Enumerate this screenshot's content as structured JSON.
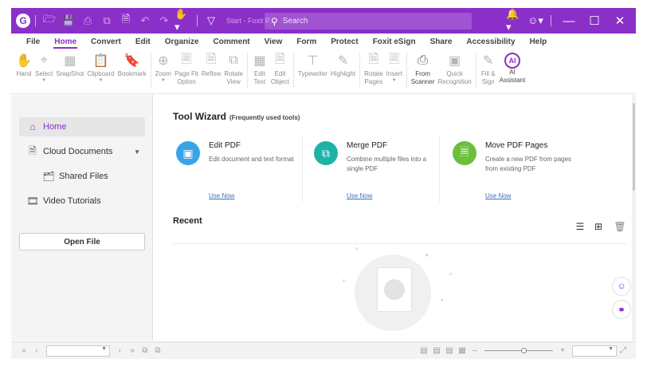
{
  "titlebar": {
    "doc_title": "Start - Foxit P...",
    "search_placeholder": "Search",
    "accent": "#8b2fc9"
  },
  "menu": {
    "tabs": [
      "File",
      "Home",
      "Convert",
      "Edit",
      "Organize",
      "Comment",
      "View",
      "Form",
      "Protect",
      "Foxit eSign",
      "Share",
      "Accessibility",
      "Help"
    ],
    "active": "Home"
  },
  "ribbon": {
    "hand": "Hand",
    "select": "Select",
    "snapshot": "SnapShot",
    "clipboard": "Clipboard",
    "bookmark": "Bookmark",
    "zoom": "Zoom",
    "page_fit_1": "Page Fit",
    "page_fit_2": "Option",
    "reflow": "Reflow",
    "rotate_view_1": "Rotate",
    "rotate_view_2": "View",
    "edit_text_1": "Edit",
    "edit_text_2": "Text",
    "edit_object_1": "Edit",
    "edit_object_2": "Object",
    "typewriter": "Typewriter",
    "highlight": "Highlight",
    "rotate_pages_1": "Rotate",
    "rotate_pages_2": "Pages",
    "insert": "Insert",
    "from_scanner_1": "From",
    "from_scanner_2": "Scanner",
    "quick_recognition_1": "Quick",
    "quick_recognition_2": "Recognition",
    "fill_sign_1": "Fill &",
    "fill_sign_2": "Sign",
    "ai_assistant_1": "AI",
    "ai_assistant_2": "Assistant",
    "ai_icon_text": "AI"
  },
  "sidebar": {
    "home": "Home",
    "cloud_documents": "Cloud Documents",
    "shared_files": "Shared Files",
    "video_tutorials": "Video Tutorials",
    "open_file": "Open File"
  },
  "wizard": {
    "title": "Tool Wizard",
    "subtitle": "(Frequently used tools)",
    "cards": [
      {
        "title": "Edit PDF",
        "desc": "Edit document and text format",
        "link": "Use Now",
        "color": "#3aa3e8"
      },
      {
        "title": "Merge PDF",
        "desc": "Combine multiple files into a single PDF",
        "link": "Use Now",
        "color": "#1fb2a6"
      },
      {
        "title": "Move PDF Pages",
        "desc": "Create a new PDF from pages from existing PDF",
        "link": "Use Now",
        "color": "#6cbf3a"
      }
    ]
  },
  "recent": {
    "title": "Recent"
  }
}
